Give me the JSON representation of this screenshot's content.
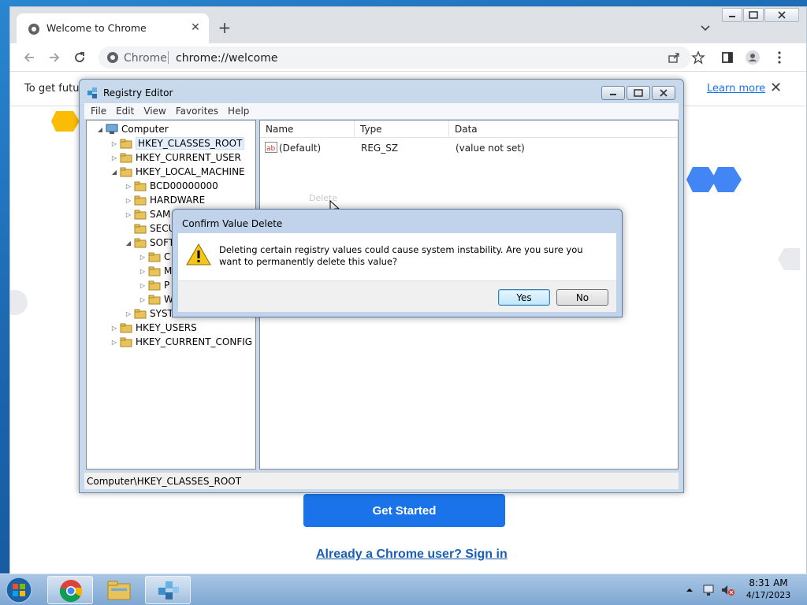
{
  "chrome": {
    "tab_title": "Welcome to Chrome",
    "omnibox_origin": "Chrome",
    "omnibox_url": "chrome://welcome",
    "infobar_text": "To get future",
    "learn_more": "Learn more",
    "get_started": "Get Started",
    "sign_in": "Already a Chrome user? Sign in"
  },
  "regedit": {
    "title": "Registry Editor",
    "menu": [
      "File",
      "Edit",
      "View",
      "Favorites",
      "Help"
    ],
    "tree": [
      {
        "label": "Computer",
        "level": 0,
        "twisty": "◢",
        "icon": "computer-icon"
      },
      {
        "label": "HKEY_CLASSES_ROOT",
        "level": 1,
        "twisty": "▷",
        "selected": true
      },
      {
        "label": "HKEY_CURRENT_USER",
        "level": 1,
        "twisty": "▷"
      },
      {
        "label": "HKEY_LOCAL_MACHINE",
        "level": 1,
        "twisty": "◢"
      },
      {
        "label": "BCD00000000",
        "level": 2,
        "twisty": "▷"
      },
      {
        "label": "HARDWARE",
        "level": 2,
        "twisty": "▷"
      },
      {
        "label": "SAM",
        "level": 2,
        "twisty": "▷"
      },
      {
        "label": "SECU",
        "level": 2,
        "twisty": ""
      },
      {
        "label": "SOFT",
        "level": 2,
        "twisty": "◢"
      },
      {
        "label": "C",
        "level": 3,
        "twisty": "▷"
      },
      {
        "label": "M",
        "level": 3,
        "twisty": "▷"
      },
      {
        "label": "P",
        "level": 3,
        "twisty": "▷"
      },
      {
        "label": "W",
        "level": 3,
        "twisty": "▷"
      },
      {
        "label": "SYST",
        "level": 2,
        "twisty": "▷"
      },
      {
        "label": "HKEY_USERS",
        "level": 1,
        "twisty": "▷"
      },
      {
        "label": "HKEY_CURRENT_CONFIG",
        "level": 1,
        "twisty": "▷"
      }
    ],
    "columns": {
      "name": "Name",
      "type": "Type",
      "data": "Data"
    },
    "values": [
      {
        "name": "(Default)",
        "type": "REG_SZ",
        "data": "(value not set)"
      }
    ],
    "faded_menu_item": "Delete",
    "status": "Computer\\HKEY_CLASSES_ROOT"
  },
  "dialog": {
    "title": "Confirm Value Delete",
    "message": "Deleting certain registry values could cause system instability. Are you sure you want to permanently delete this value?",
    "yes": "Yes",
    "no": "No"
  },
  "taskbar": {
    "time": "8:31 AM",
    "date": "4/17/2023"
  },
  "colors": {
    "chrome_blue": "#1a73e8",
    "window_frame": "#c9d9ec",
    "taskbar": "#a9c6e4"
  }
}
